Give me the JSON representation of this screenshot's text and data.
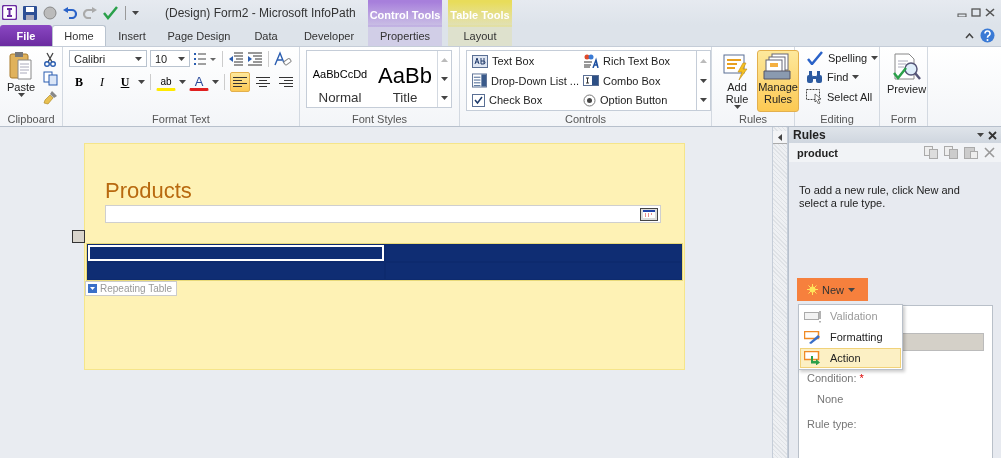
{
  "window": {
    "title": "(Design) Form2  -  Microsoft InfoPath"
  },
  "context_tabs": [
    {
      "label": "Control Tools",
      "color": "#a77fdb"
    },
    {
      "label": "Table Tools",
      "color": "#e8dc5a"
    }
  ],
  "tabs": [
    {
      "label": "File",
      "kind": "file",
      "selected": false
    },
    {
      "label": "Home",
      "kind": "normal",
      "selected": true
    },
    {
      "label": "Insert",
      "kind": "normal",
      "selected": false
    },
    {
      "label": "Page Design",
      "kind": "normal",
      "selected": false
    },
    {
      "label": "Data",
      "kind": "normal",
      "selected": false
    },
    {
      "label": "Developer",
      "kind": "normal",
      "selected": false
    },
    {
      "label": "Properties",
      "kind": "context",
      "selected": false
    },
    {
      "label": "Layout",
      "kind": "context",
      "selected": false
    }
  ],
  "ribbon": [
    {
      "kind": "clipboard",
      "label": "Clipboard",
      "paste": "Paste"
    },
    {
      "kind": "format",
      "label": "Format Text",
      "font": "Calibri",
      "size": "10",
      "bold": "B",
      "italic": "I",
      "underline": "U",
      "highlight": "ab",
      "font_color": "A",
      "alignments": [
        {
          "selected": true
        },
        {
          "selected": false
        },
        {
          "selected": false
        }
      ]
    },
    {
      "kind": "styles",
      "label": "Font Styles",
      "styles": [
        {
          "sample": "AaBbCcDd",
          "name": "Normal"
        },
        {
          "sample": "AaBb",
          "name": "Title"
        }
      ]
    },
    {
      "kind": "controls",
      "label": "Controls",
      "items": [
        {
          "label": "Text Box",
          "kind": "textbox"
        },
        {
          "label": "Rich Text Box",
          "kind": "richtext"
        },
        {
          "label": "Drop-Down List ...",
          "kind": "dropdown"
        },
        {
          "label": "Combo Box",
          "kind": "combo"
        },
        {
          "label": "Check Box",
          "kind": "checkbox"
        },
        {
          "label": "Option Button",
          "kind": "option"
        }
      ]
    },
    {
      "kind": "rules",
      "label": "Rules",
      "buttons": [
        {
          "label": "Add Rule",
          "kind": "add",
          "selected": false
        },
        {
          "label": "Manage Rules",
          "kind": "manage",
          "selected": true
        }
      ]
    },
    {
      "kind": "editing",
      "label": "Editing",
      "items": [
        {
          "label": "Spelling",
          "kind": "spelling"
        },
        {
          "label": "Find",
          "kind": "find"
        },
        {
          "label": "Select All",
          "kind": "selectall"
        }
      ]
    },
    {
      "kind": "form",
      "label": "Form",
      "button": "Preview"
    }
  ],
  "form": {
    "title": "Products",
    "repeating_table": {
      "label": "Repeating Table",
      "rows": [
        {
          "cells": [
            {
              "selected": true
            },
            {
              "selected": false
            }
          ]
        },
        {
          "cells": [
            {
              "selected": false
            },
            {
              "selected": false
            }
          ]
        }
      ]
    }
  },
  "rules_pane": {
    "title": "Rules",
    "field": "product",
    "hint": "To add a new rule, click New and select a rule type.",
    "new_button": "New",
    "menu": [
      {
        "label": "Validation",
        "kind": "validation",
        "disabled": true,
        "selected": false
      },
      {
        "label": "Formatting",
        "kind": "formatting",
        "disabled": false,
        "selected": false
      },
      {
        "label": "Action",
        "kind": "action",
        "disabled": false,
        "selected": true
      }
    ],
    "condition_label": "Condition:",
    "required_mark": "*",
    "condition_value": "None",
    "rule_type_label": "Rule type:"
  }
}
